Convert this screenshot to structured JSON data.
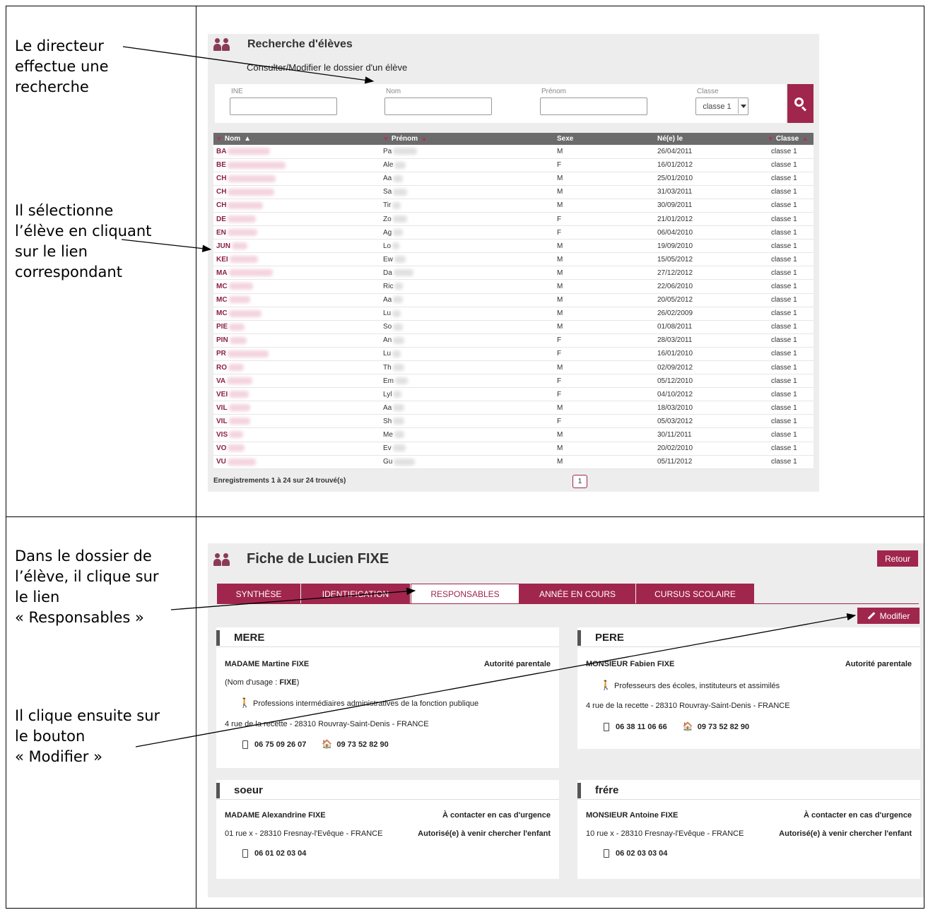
{
  "notes": {
    "n1": [
      "Le directeur",
      "effectue une",
      "recherche"
    ],
    "n2": [
      "Il sélectionne",
      "l’élève en cliquant",
      "sur le lien",
      "correspondant"
    ],
    "n3": [
      "Dans le dossier de",
      "l’élève, il clique sur",
      "le lien",
      "« Responsables »"
    ],
    "n4": [
      "Il clique ensuite sur",
      "le bouton",
      "« Modifier »"
    ]
  },
  "search": {
    "title": "Recherche d'élèves",
    "subtitle": "Consulter/Modifier le dossier d'un élève",
    "labels": {
      "ine": "INE",
      "nom": "Nom",
      "prenom": "Prénom",
      "classe": "Classe"
    },
    "classe_value": "classe 1",
    "search_icon": "search-icon"
  },
  "table": {
    "headers": [
      "Nom",
      "Prénom",
      "Sexe",
      "Né(e) le",
      "Classe"
    ],
    "rows": [
      [
        "BA",
        "Pa",
        "M",
        "26/04/2011",
        "classe 1"
      ],
      [
        "BE",
        "Ale",
        "F",
        "16/01/2012",
        "classe 1"
      ],
      [
        "CH",
        "Aa",
        "M",
        "25/01/2010",
        "classe 1"
      ],
      [
        "CH",
        "Sa",
        "M",
        "31/03/2011",
        "classe 1"
      ],
      [
        "CH",
        "Tir",
        "M",
        "30/09/2011",
        "classe 1"
      ],
      [
        "DE",
        "Zo",
        "F",
        "21/01/2012",
        "classe 1"
      ],
      [
        "EN",
        "Ag",
        "F",
        "06/04/2010",
        "classe 1"
      ],
      [
        "JUN",
        "Lo",
        "M",
        "19/09/2010",
        "classe 1"
      ],
      [
        "KEI",
        "Ew",
        "M",
        "15/05/2012",
        "classe 1"
      ],
      [
        "MA",
        "Da",
        "M",
        "27/12/2012",
        "classe 1"
      ],
      [
        "MC",
        "Ric",
        "M",
        "22/06/2010",
        "classe 1"
      ],
      [
        "MC",
        "Aa",
        "M",
        "20/05/2012",
        "classe 1"
      ],
      [
        "MC",
        "Lu",
        "M",
        "26/02/2009",
        "classe 1"
      ],
      [
        "PIE",
        "So",
        "M",
        "01/08/2011",
        "classe 1"
      ],
      [
        "PIN",
        "An",
        "F",
        "28/03/2011",
        "classe 1"
      ],
      [
        "PR",
        "Lu",
        "F",
        "16/01/2010",
        "classe 1"
      ],
      [
        "RO",
        "Th",
        "M",
        "02/09/2012",
        "classe 1"
      ],
      [
        "VA",
        "Em",
        "F",
        "05/12/2010",
        "classe 1"
      ],
      [
        "VEI",
        "Lyl",
        "F",
        "04/10/2012",
        "classe 1"
      ],
      [
        "VIL",
        "Aa",
        "M",
        "18/03/2010",
        "classe 1"
      ],
      [
        "VIL",
        "Sh",
        "F",
        "05/03/2012",
        "classe 1"
      ],
      [
        "VIS",
        "Me",
        "M",
        "30/11/2011",
        "classe 1"
      ],
      [
        "VO",
        "Ev",
        "M",
        "20/02/2010",
        "classe 1"
      ],
      [
        "VU",
        "Gu",
        "M",
        "05/11/2012",
        "classe 1"
      ]
    ],
    "records": "Enregistrements 1 à 24 sur 24 trouvé(s)",
    "page": "1"
  },
  "fiche": {
    "title": "Fiche de Lucien FIXE",
    "retour": "Retour",
    "tabs": [
      "SYNTHÈSE",
      "IDENTIFICATION",
      "RESPONSABLES",
      "ANNÉE EN COURS",
      "CURSUS SCOLAIRE"
    ],
    "modifier": "Modifier",
    "mere": {
      "head": "MERE",
      "name": "MADAME Martine FIXE",
      "role": "Autorité parentale",
      "usage_prefix": "(Nom d'usage : ",
      "usage_name": "FIXE",
      "usage_suffix": ")",
      "job": "Professions intermédiaires administratives de la fonction publique",
      "address": "4 rue de la recette - 28310 Rouvray-Saint-Denis - FRANCE",
      "mobile": "06 75 09 26 07",
      "home": "09 73 52 82 90"
    },
    "pere": {
      "head": "PERE",
      "name": "MONSIEUR Fabien FIXE",
      "role": "Autorité parentale",
      "job": "Professeurs des écoles, instituteurs et assimilés",
      "address": "4 rue de la recette - 28310 Rouvray-Saint-Denis - FRANCE",
      "mobile": "06 38 11 06 66",
      "home": "09 73 52 82 90"
    },
    "soeur": {
      "head": "soeur",
      "name": "MADAME Alexandrine FIXE",
      "role1": "À contacter en cas d'urgence",
      "role2": "Autorisé(e) à venir chercher l'enfant",
      "address": "01 rue x - 28310 Fresnay-l'Evêque - FRANCE",
      "mobile": "06 01 02 03 04"
    },
    "frere": {
      "head": "frére",
      "name": "MONSIEUR Antoine FIXE",
      "role1": "À contacter en cas d'urgence",
      "role2": "Autorisé(e) à venir chercher l'enfant",
      "address": "10 rue x - 28310 Fresnay-l'Evêque - FRANCE",
      "mobile": "06 02 03 03 04"
    }
  },
  "colors": {
    "accent": "#a0264e",
    "header_grey": "#6b6b6b",
    "panel_bg": "#ededed"
  }
}
